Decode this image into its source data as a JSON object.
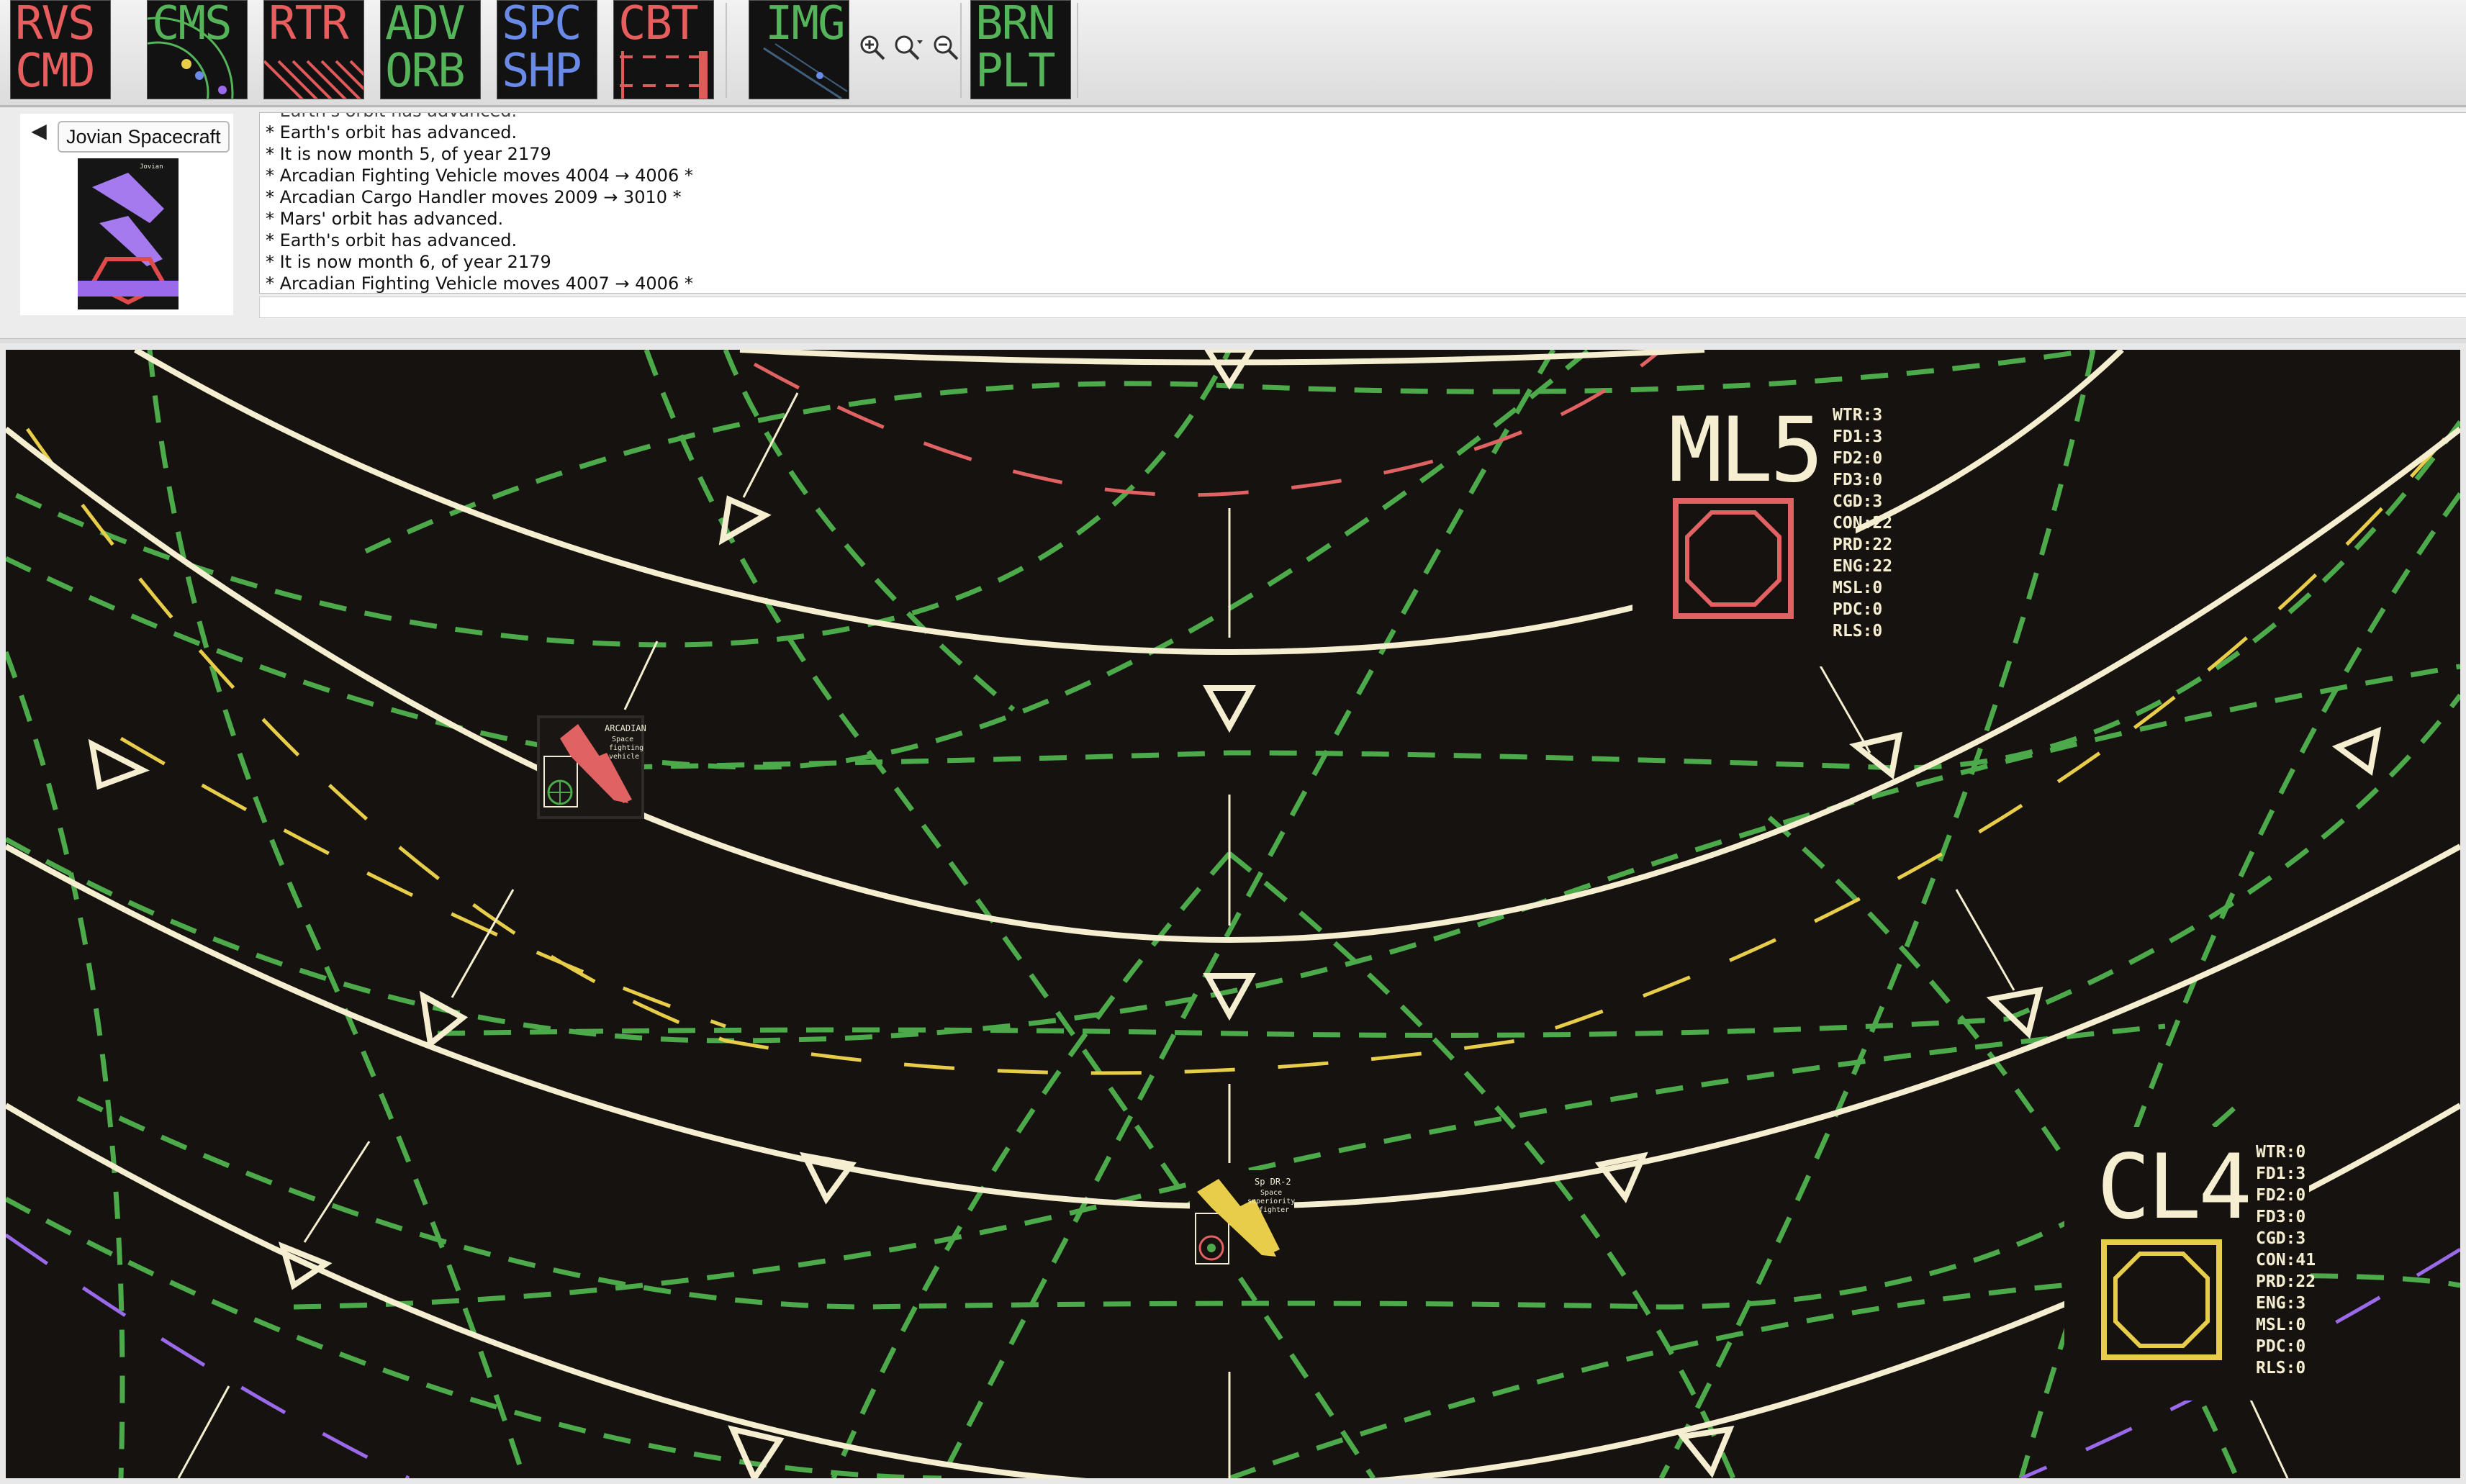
{
  "colors": {
    "map_bg": "#15120f",
    "orbit_primary": "#f6eed0",
    "route": "#4caa4a",
    "mars": "#e06262",
    "yellow": "#e7cd4a",
    "purple": "#9a6aea",
    "btn_red": "#e05a5a",
    "btn_green": "#55b45a",
    "btn_blue": "#6a8ae8"
  },
  "toolbar": {
    "buttons": [
      {
        "line1": "RVS",
        "line2": "CMD",
        "color": "#e85e5e"
      },
      {
        "line1": "CMS",
        "line2": "",
        "color": "#55b45a"
      },
      {
        "line1": "RTR",
        "line2": "",
        "color": "#e85e5e"
      },
      {
        "line1": "ADV",
        "line2": "ORB",
        "color": "#55b45a"
      },
      {
        "line1": "SPC",
        "line2": "SHP",
        "color": "#6a8ae8"
      },
      {
        "line1": "CBT",
        "line2": "",
        "color": "#e85e5e"
      },
      {
        "line1": "IMG",
        "line2": "",
        "color": "#55b45a"
      },
      {
        "line1": "BRN",
        "line2": "PLT",
        "color": "#55b45a"
      }
    ],
    "zoom_icons": [
      "zoom-in-icon",
      "zoom-menu-icon",
      "zoom-out-icon"
    ]
  },
  "ship_panel": {
    "name": "Jovian Spacecraft",
    "back_icon": "left-arrow-icon"
  },
  "log": {
    "lines": [
      "* Earth's orbit has advanced.",
      "* It is now month 5, of year 2179",
      "* Arcadian Fighting Vehicle moves 4004 → 4006 *",
      "* Arcadian Cargo Handler moves 2009 → 3010 *",
      "* Mars' orbit has advanced.",
      "* Earth's orbit has advanced.",
      "* It is now month 6, of year 2179",
      "* Arcadian Fighting Vehicle moves 4007 → 4006 *"
    ]
  },
  "map": {
    "planets": [
      {
        "label": "ML5",
        "color": "#e06262",
        "stats": [
          "WTR:3",
          "FD1:3",
          "FD2:0",
          "FD3:0",
          "CGD:3",
          "CON:22",
          "PRD:22",
          "ENG:22",
          "MSL:0",
          "PDC:0",
          "RLS:0"
        ]
      },
      {
        "label": "CL4",
        "color": "#e7cd4a",
        "stats": [
          "WTR:0",
          "FD1:3",
          "FD2:0",
          "FD3:0",
          "CGD:3",
          "CON:41",
          "PRD:22",
          "ENG:3",
          "MSL:0",
          "PDC:0",
          "RLS:0"
        ]
      }
    ]
  }
}
